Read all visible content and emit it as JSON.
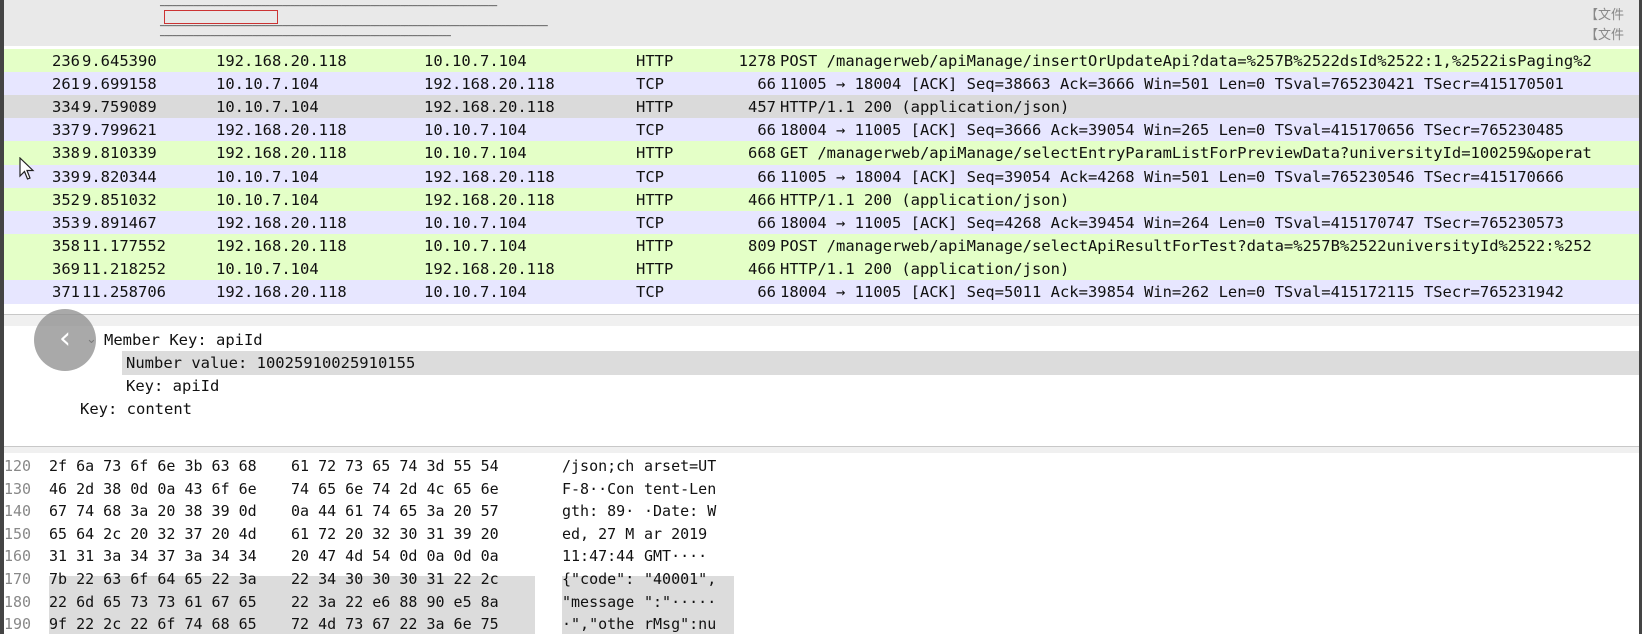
{
  "packets": [
    {
      "no": "236",
      "time": "9.645390",
      "src": "192.168.20.118",
      "dst": "10.10.7.104",
      "proto": "HTTP",
      "len": "1278",
      "info": "POST /managerweb/apiManage/insertOrUpdateApi?data=%257B%2522dsId%2522:1,%2522isPaging%2",
      "kind": "http"
    },
    {
      "no": "261",
      "time": "9.699158",
      "src": "10.10.7.104",
      "dst": "192.168.20.118",
      "proto": "TCP",
      "len": "66",
      "info": "11005 → 18004 [ACK] Seq=38663 Ack=3666 Win=501 Len=0 TSval=765230421 TSecr=415170501",
      "kind": "tcp"
    },
    {
      "no": "334",
      "time": "9.759089",
      "src": "10.10.7.104",
      "dst": "192.168.20.118",
      "proto": "HTTP",
      "len": "457",
      "info": "HTTP/1.1 200   (application/json)",
      "kind": "sel"
    },
    {
      "no": "337",
      "time": "9.799621",
      "src": "192.168.20.118",
      "dst": "10.10.7.104",
      "proto": "TCP",
      "len": "66",
      "info": "18004 → 11005 [ACK] Seq=3666 Ack=39054 Win=265 Len=0 TSval=415170656 TSecr=765230485",
      "kind": "tcp"
    },
    {
      "no": "338",
      "time": "9.810339",
      "src": "192.168.20.118",
      "dst": "10.10.7.104",
      "proto": "HTTP",
      "len": "668",
      "info": "GET /managerweb/apiManage/selectEntryParamListForPreviewData?universityId=100259&operat",
      "kind": "http"
    },
    {
      "no": "339",
      "time": "9.820344",
      "src": "10.10.7.104",
      "dst": "192.168.20.118",
      "proto": "TCP",
      "len": "66",
      "info": "11005 → 18004 [ACK] Seq=39054 Ack=4268 Win=501 Len=0 TSval=765230546 TSecr=415170666",
      "kind": "tcp"
    },
    {
      "no": "352",
      "time": "9.851032",
      "src": "10.10.7.104",
      "dst": "192.168.20.118",
      "proto": "HTTP",
      "len": "466",
      "info": "HTTP/1.1 200   (application/json)",
      "kind": "http"
    },
    {
      "no": "353",
      "time": "9.891467",
      "src": "192.168.20.118",
      "dst": "10.10.7.104",
      "proto": "TCP",
      "len": "66",
      "info": "18004 → 11005 [ACK] Seq=4268 Ack=39454 Win=264 Len=0 TSval=415170747 TSecr=765230573",
      "kind": "tcp"
    },
    {
      "no": "358",
      "time": "11.177552",
      "src": "192.168.20.118",
      "dst": "10.10.7.104",
      "proto": "HTTP",
      "len": "809",
      "info": "POST /managerweb/apiManage/selectApiResultForTest?data=%257B%2522universityId%2522:%252",
      "kind": "http"
    },
    {
      "no": "369",
      "time": "11.218252",
      "src": "10.10.7.104",
      "dst": "192.168.20.118",
      "proto": "HTTP",
      "len": "466",
      "info": "HTTP/1.1 200   (application/json)",
      "kind": "http"
    },
    {
      "no": "371",
      "time": "11.258706",
      "src": "192.168.20.118",
      "dst": "10.10.7.104",
      "proto": "TCP",
      "len": "66",
      "info": "18004 → 11005 [ACK] Seq=5011 Ack=39854 Win=262 Len=0 TSval=415172115 TSecr=765231942",
      "kind": "tcp"
    }
  ],
  "details": [
    {
      "text": "Member Key: apiId",
      "chevron": "⌄",
      "highlight": false
    },
    {
      "text": "Number value: 10025910025910155",
      "chevron": "",
      "highlight": true
    },
    {
      "text": "Key: apiId",
      "chevron": "",
      "highlight": false
    },
    {
      "text": "Key: content",
      "chevron": "",
      "highlight": false
    }
  ],
  "bytes": [
    {
      "off": "120",
      "hexa": "2f 6a 73 6f 6e 3b 63 68",
      "hexb": "61 72 73 65 74 3d 55 54",
      "asca": "/json;ch",
      "ascb": "arset=UT"
    },
    {
      "off": "130",
      "hexa": "46 2d 38 0d 0a 43 6f 6e",
      "hexb": "74 65 6e 74 2d 4c 65 6e",
      "asca": "F-8··Con",
      "ascb": "tent-Len"
    },
    {
      "off": "140",
      "hexa": "67 74 68 3a 20 38 39 0d",
      "hexb": "0a 44 61 74 65 3a 20 57",
      "asca": "gth: 89·",
      "ascb": "·Date: W"
    },
    {
      "off": "150",
      "hexa": "65 64 2c 20 32 37 20 4d",
      "hexb": "61 72 20 32 30 31 39 20",
      "asca": "ed, 27 M",
      "ascb": "ar 2019 "
    },
    {
      "off": "160",
      "hexa": "31 31 3a 34 37 3a 34 34",
      "hexb": "20 47 4d 54 0d 0a 0d 0a",
      "asca": "11:47:44",
      "ascb": " GMT····"
    },
    {
      "off": "170",
      "hexa": "7b 22 63 6f 64 65 22 3a",
      "hexb": "22 34 30 30 30 31 22 2c",
      "asca": "{\"code\":",
      "ascb": "\"40001\","
    },
    {
      "off": "180",
      "hexa": "22 6d 65 73 73 61 67 65",
      "hexb": "22 3a 22 e6 88 90 e5 8a",
      "asca": "\"message",
      "ascb": "\":\"·····"
    },
    {
      "off": "190",
      "hexa": "9f 22 2c 22 6f 74 68 65",
      "hexb": "72 4d 73 67 22 3a 6e 75",
      "asca": "·\",\"othe",
      "ascb": "rMsg\":nu"
    }
  ],
  "background": {
    "wj1": "【文件",
    "wj2": "【文件"
  },
  "colors": {
    "http_row": "#e4ffc7",
    "tcp_row": "#e7e6ff",
    "selected_row": "#dadada"
  },
  "icons": [
    "back-arrow-icon",
    "mouse-cursor-icon",
    "chevron-down-icon"
  ]
}
